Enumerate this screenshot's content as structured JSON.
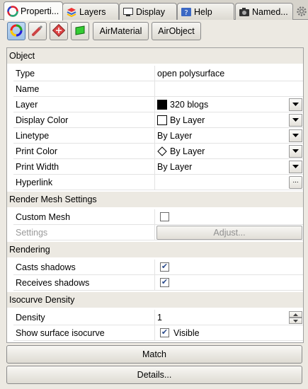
{
  "tabs": [
    {
      "label": "Properti...",
      "icon": "properties-icon"
    },
    {
      "label": "Layers",
      "icon": "layers-icon"
    },
    {
      "label": "Display",
      "icon": "display-icon"
    },
    {
      "label": "Help",
      "icon": "help-icon"
    },
    {
      "label": "Named...",
      "icon": "camera-icon"
    }
  ],
  "toolbar": {
    "air_material": "AirMaterial",
    "air_object": "AirObject"
  },
  "sections": {
    "object": "Object",
    "render_mesh": "Render Mesh Settings",
    "rendering": "Rendering",
    "isocurve": "Isocurve Density"
  },
  "object": {
    "type_label": "Type",
    "type_value": "open polysurface",
    "name_label": "Name",
    "name_value": "",
    "layer_label": "Layer",
    "layer_value": "320 blogs",
    "display_color_label": "Display Color",
    "display_color_value": "By Layer",
    "linetype_label": "Linetype",
    "linetype_value": "By Layer",
    "print_color_label": "Print Color",
    "print_color_value": "By Layer",
    "print_width_label": "Print Width",
    "print_width_value": "By Layer",
    "hyperlink_label": "Hyperlink",
    "hyperlink_value": "",
    "ellipsis": "..."
  },
  "render_mesh": {
    "custom_mesh_label": "Custom Mesh",
    "custom_mesh_checked": false,
    "settings_label": "Settings",
    "adjust_label": "Adjust..."
  },
  "rendering": {
    "casts_label": "Casts shadows",
    "casts_checked": true,
    "receives_label": "Receives shadows",
    "receives_checked": true
  },
  "isocurve": {
    "density_label": "Density",
    "density_value": "1",
    "show_label": "Show surface isocurve",
    "show_checked": true,
    "show_value": "Visible"
  },
  "buttons": {
    "match": "Match",
    "details": "Details..."
  },
  "colors": {
    "layer_swatch": "#000000",
    "display_swatch": "#ffffff",
    "section_bg": "#ece9e2"
  }
}
